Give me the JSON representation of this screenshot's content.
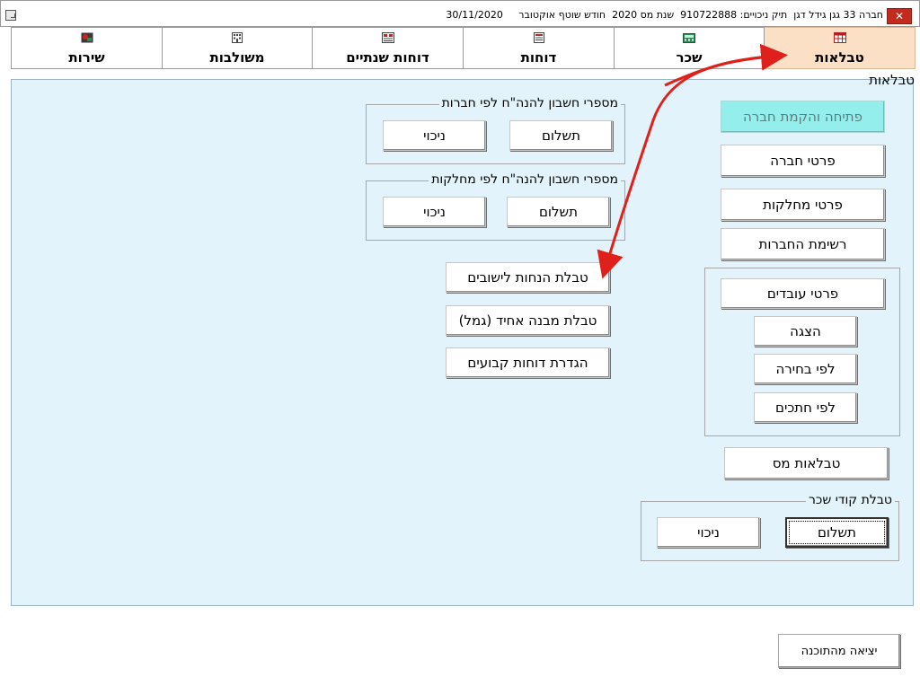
{
  "window": {
    "title": "חברה 33 גגן גידל דגן  תיק ניכויים: 910722888  שנת מס 2020  חודש שוטף אוקטובר     30/11/2020",
    "close_symbol": "✕"
  },
  "tabs": [
    {
      "label": "טבלאות",
      "icon": "table-icon",
      "active": true
    },
    {
      "label": "שכר",
      "icon": "calculator-icon",
      "active": false
    },
    {
      "label": "דוחות",
      "icon": "report-icon",
      "active": false
    },
    {
      "label": "דוחות שנתיים",
      "icon": "annual-report-icon",
      "active": false
    },
    {
      "label": "משולבות",
      "icon": "building-icon",
      "active": false
    },
    {
      "label": "שירות",
      "icon": "service-icon",
      "active": false
    }
  ],
  "panel": {
    "title": "טבלאות",
    "buttons": {
      "open_company": "פתיחה והקמת חברה",
      "company_details": "פרטי חברה",
      "department_details": "פרטי מחלקות",
      "company_list": "רשימת החברות",
      "employee_details": "פרטי עובדים",
      "display": "הצגה",
      "by_selection": "לפי בחירה",
      "by_sections": "לפי חתכים",
      "tax_tables": "טבלאות מס",
      "settlement_discounts": "טבלת הנחות לישובים",
      "uniform_structure": "טבלת מבנה אחיד (גמל)",
      "fixed_reports": "הגדרת דוחות קבועים"
    },
    "groups": {
      "accounts_by_company": {
        "title": "מספרי חשבון להנה\"ח לפי חברות",
        "payment": "תשלום",
        "deduction": "ניכוי"
      },
      "accounts_by_department": {
        "title": "מספרי חשבון להנה\"ח לפי מחלקות",
        "payment": "תשלום",
        "deduction": "ניכוי"
      },
      "salary_codes": {
        "title": "טבלת קודי שכר",
        "payment": "תשלום",
        "deduction": "ניכוי"
      }
    }
  },
  "footer": {
    "exit_label": "יציאה מהתוכנה"
  },
  "colors": {
    "active_tab": "#fce0c6",
    "panel_bg": "#e2f3fb",
    "disabled_button": "#93eeec",
    "annotation_arrow": "#e0201a"
  }
}
